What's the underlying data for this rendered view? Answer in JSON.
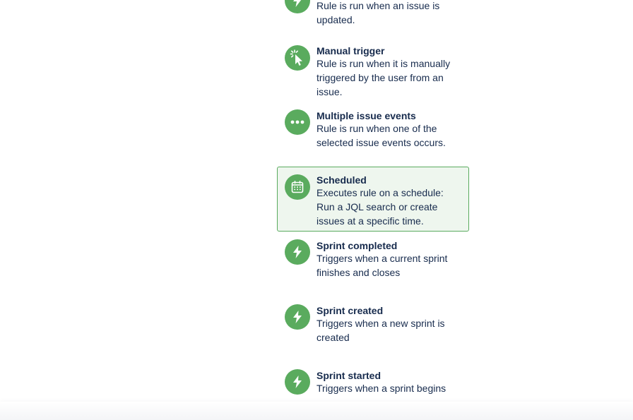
{
  "triggers": [
    {
      "title": "",
      "description": "Rule is run when an issue is updated.",
      "icon": "lightning-icon"
    },
    {
      "title": "Manual trigger",
      "description": "Rule is run when it is manually triggered by the user from an issue.",
      "icon": "cursor-click-icon"
    },
    {
      "title": "Multiple issue events",
      "description": "Rule is run when one of the selected issue events occurs.",
      "icon": "more-dots-icon"
    },
    {
      "title": "Scheduled",
      "description": "Executes rule on a schedule: Run a JQL search or create issues at a specific time.",
      "icon": "calendar-icon",
      "selected": true
    },
    {
      "title": "Sprint completed",
      "description": "Triggers when a current sprint finishes and closes",
      "icon": "lightning-icon"
    },
    {
      "title": "Sprint created",
      "description": "Triggers when a new sprint is created",
      "icon": "lightning-icon"
    },
    {
      "title": "Sprint started",
      "description": "Triggers when a sprint begins",
      "icon": "lightning-icon"
    }
  ],
  "colors": {
    "icon_bg": "#5aab5e",
    "selected_bg": "#eef6ee",
    "selected_border": "#5aab5e",
    "text": "#172b4d"
  }
}
